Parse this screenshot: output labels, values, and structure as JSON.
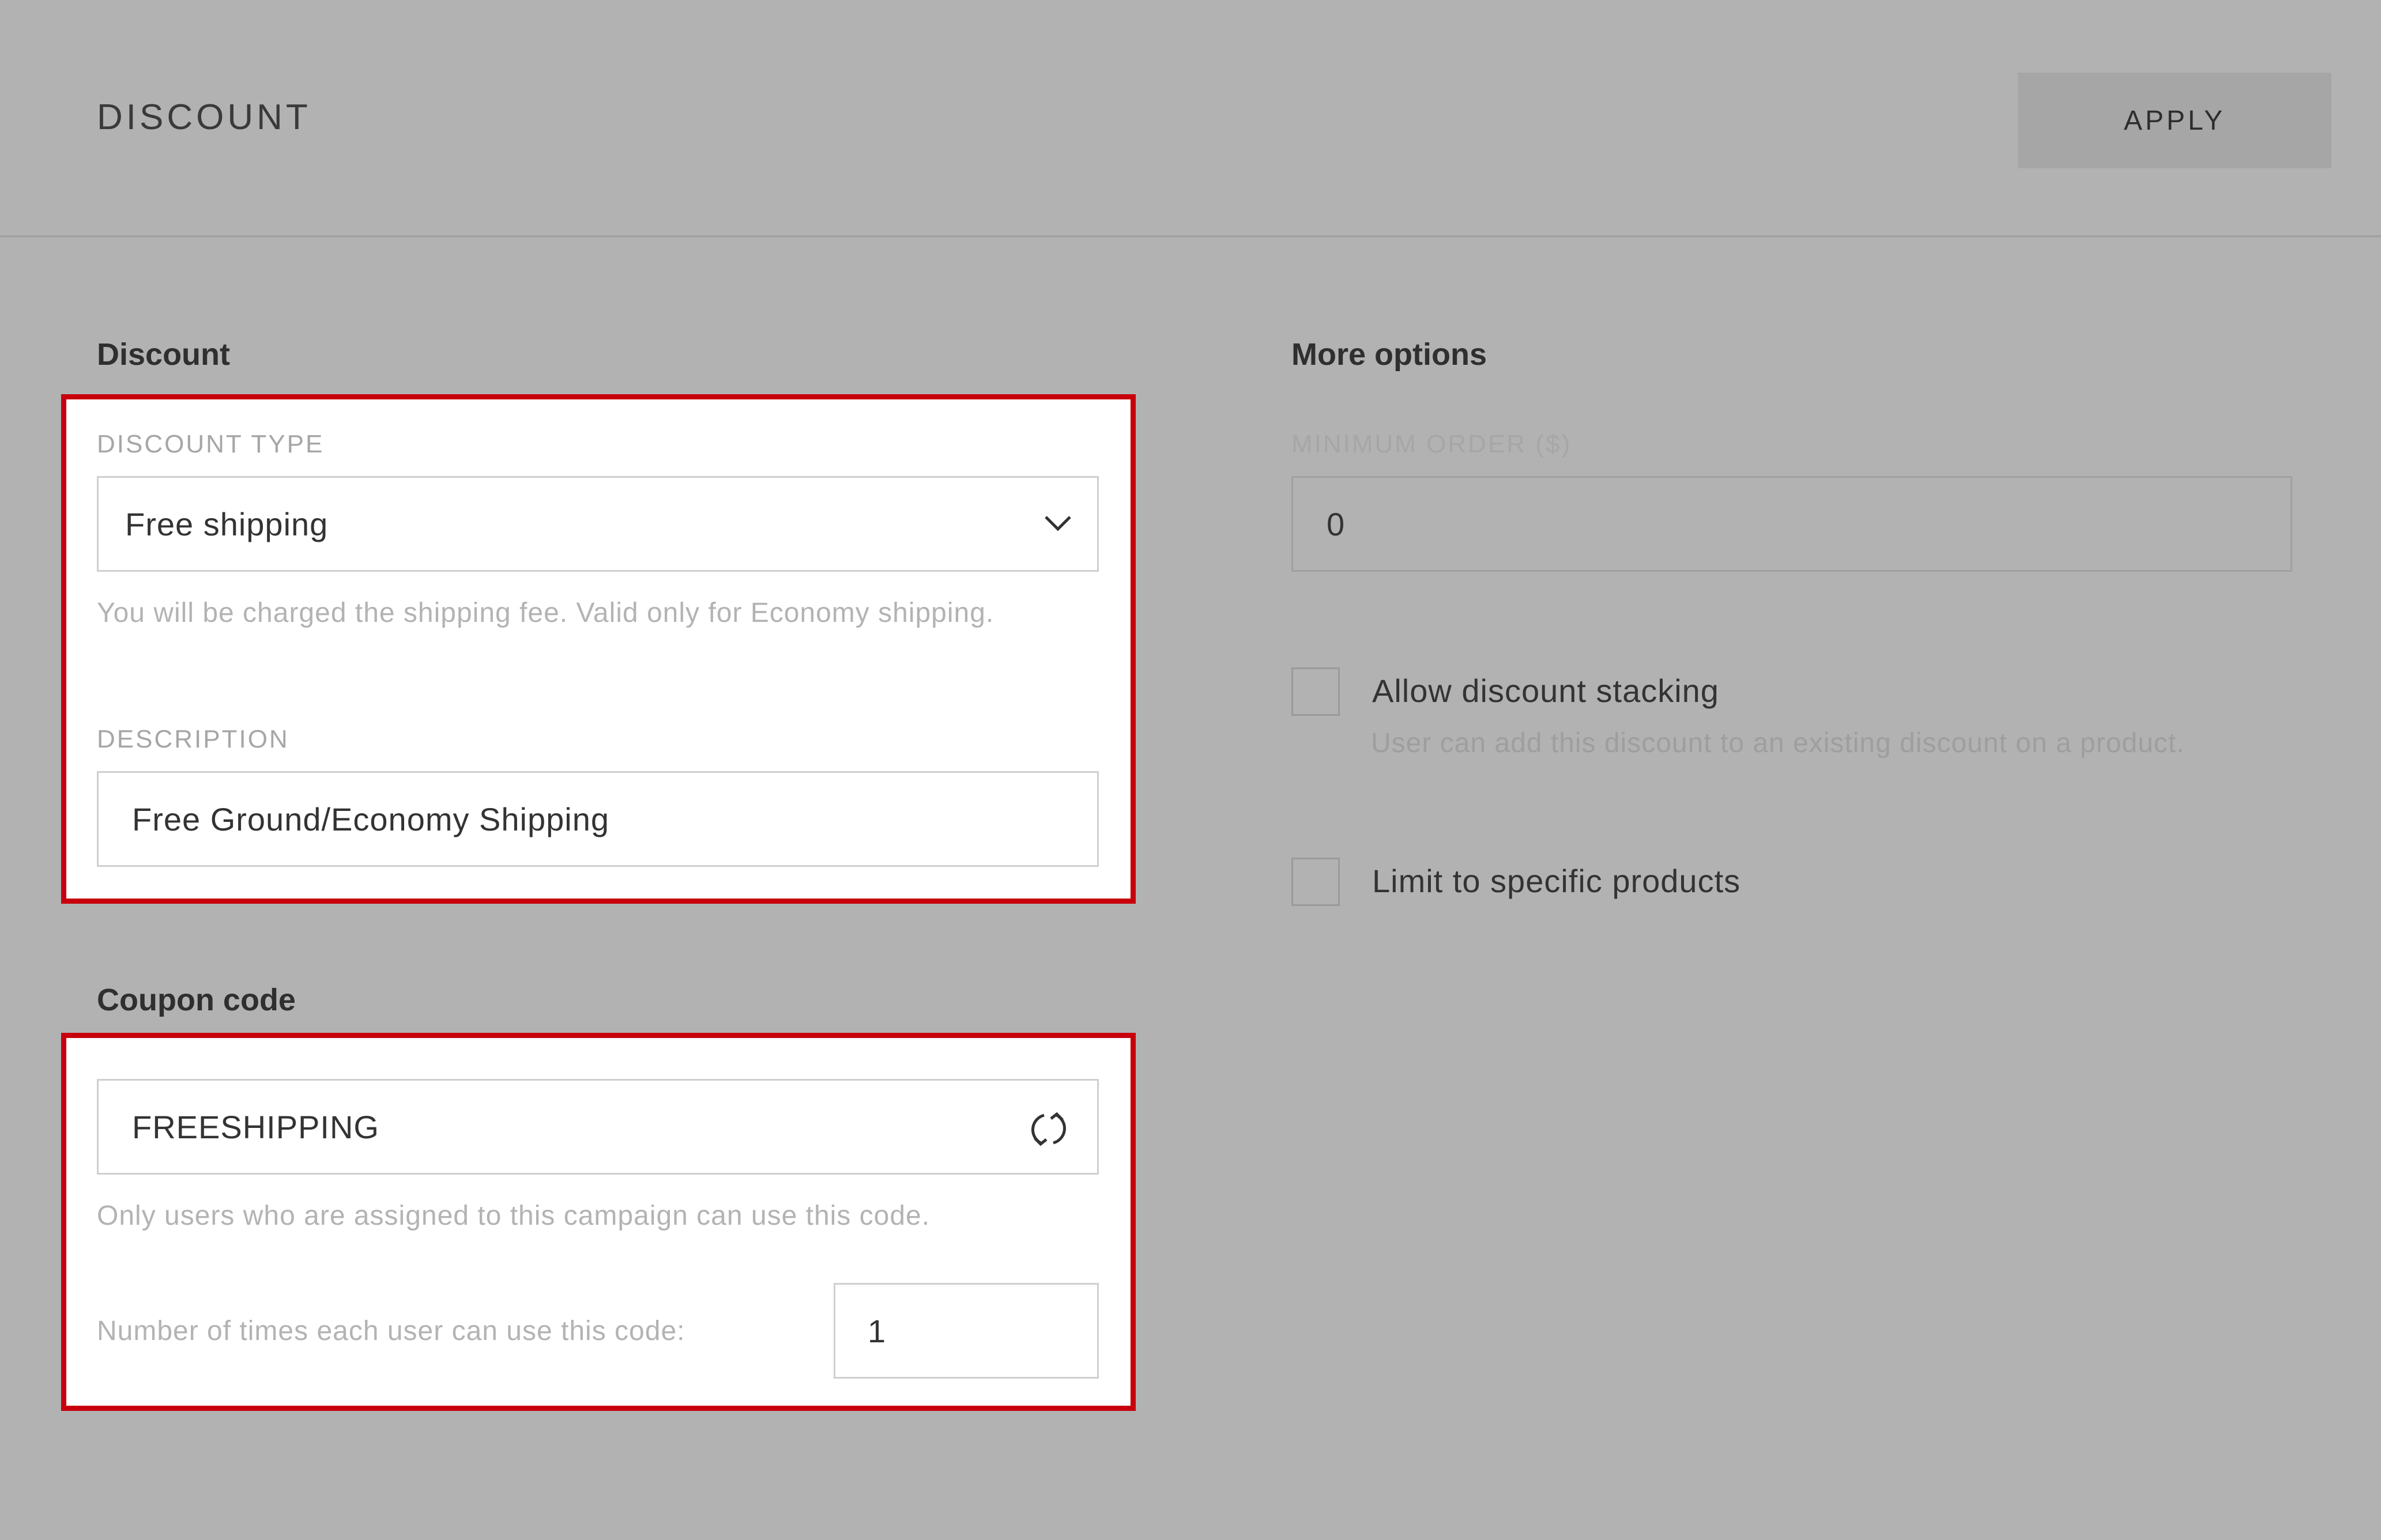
{
  "header": {
    "title": "DISCOUNT",
    "apply_label": "APPLY"
  },
  "discount": {
    "heading": "Discount",
    "type_label": "DISCOUNT TYPE",
    "type_value": "Free shipping",
    "type_help": "You will be charged the shipping fee. Valid only for Economy shipping.",
    "description_label": "DESCRIPTION",
    "description_value": "Free Ground/Economy Shipping"
  },
  "coupon": {
    "heading": "Coupon code",
    "code_value": "FREESHIPPING",
    "code_help": "Only users who are assigned to this campaign can use this code.",
    "uses_label": "Number of times each user can use this code:",
    "uses_value": "1"
  },
  "more_options": {
    "heading": "More options",
    "minimum_order_label": "MINIMUM ORDER ($)",
    "minimum_order_value": "0",
    "stacking_label": "Allow discount stacking",
    "stacking_help": "User can add this discount to an existing discount on a product.",
    "stacking_checked": false,
    "limit_label": "Limit to specific products",
    "limit_checked": false
  },
  "icons": {
    "dropdown": "chevron-down-icon",
    "regenerate": "refresh-icon"
  },
  "colors": {
    "background": "#b2b2b2",
    "highlight": "#c8000c",
    "panel": "#ffffff"
  }
}
